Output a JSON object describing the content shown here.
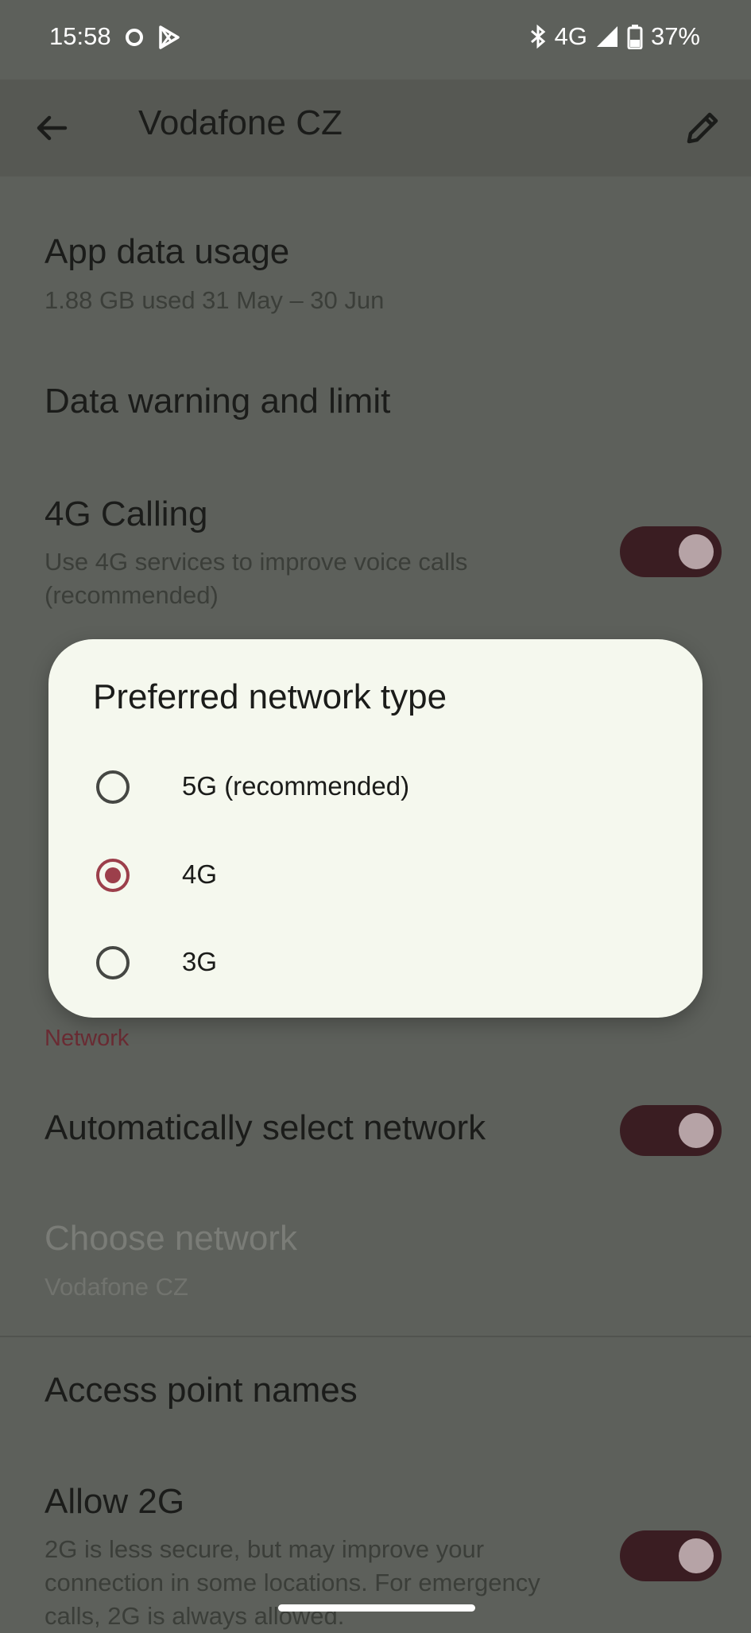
{
  "status_bar": {
    "time": "15:58",
    "icons": [
      "circle-icon",
      "play-store-icon"
    ],
    "bluetooth": "bluetooth-icon",
    "network": "4G",
    "battery": "37%"
  },
  "app_bar": {
    "title": "Vodafone CZ"
  },
  "settings": {
    "app_data_usage": {
      "title": "App data usage",
      "subtitle": "1.88 GB used 31 May – 30 Jun"
    },
    "data_warning": {
      "title": "Data warning and limit"
    },
    "calling_4g": {
      "title": "4G Calling",
      "subtitle": "Use 4G services to improve voice calls (recommended)",
      "enabled": true
    },
    "network_section": "Network",
    "auto_select": {
      "title": "Automatically select network",
      "enabled": true
    },
    "choose_network": {
      "title": "Choose network",
      "subtitle": "Vodafone CZ"
    },
    "apn": {
      "title": "Access point names"
    },
    "allow_2g": {
      "title": "Allow 2G",
      "subtitle": "2G is less secure, but may improve your connection in some locations. For emergency calls, 2G is always allowed.",
      "enabled": true
    }
  },
  "dialog": {
    "title": "Preferred network type",
    "options": [
      {
        "label": "5G (recommended)",
        "selected": false
      },
      {
        "label": "4G",
        "selected": true
      },
      {
        "label": "3G",
        "selected": false
      }
    ]
  },
  "colors": {
    "accent": "#9c3f4b",
    "scrim_background": "#5d605b",
    "dialog_background": "#f5f8ee"
  }
}
